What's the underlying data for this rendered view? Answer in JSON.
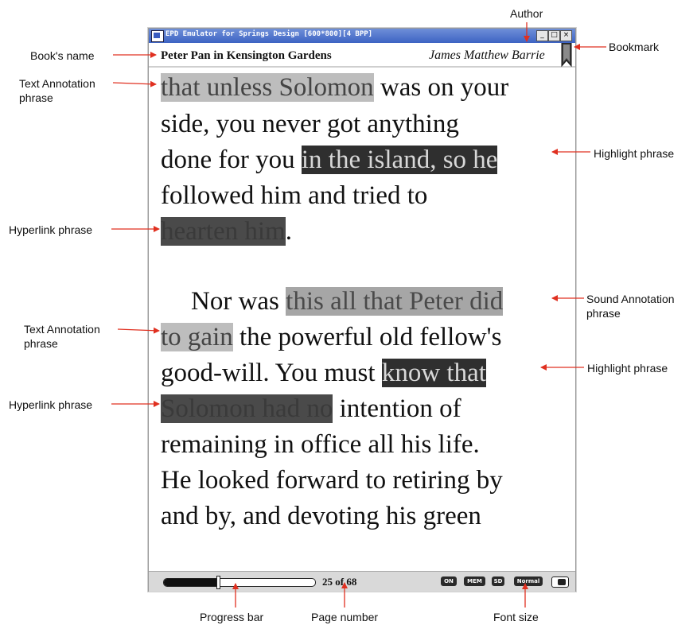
{
  "labels": {
    "author": "Author",
    "bookmark": "Bookmark",
    "book_name": "Book's name",
    "text_annotation_1": "Text Annotation phrase",
    "highlight_1": "Highlight phrase",
    "hyperlink_1": "Hyperlink phrase",
    "sound_annotation": "Sound Annotation phrase",
    "text_annotation_2": "Text Annotation phrase",
    "highlight_2": "Highlight phrase",
    "hyperlink_2": "Hyperlink phrase",
    "progress_bar": "Progress bar",
    "page_number": "Page number",
    "font_size": "Font size"
  },
  "window": {
    "title": "EPD Emulator for Springs Design [600*800][4 BPP]",
    "minimize": "_",
    "maximize": "□",
    "close": "×"
  },
  "book": {
    "name": "Peter Pan in Kensington Gardens",
    "author": "James Matthew Barrie"
  },
  "text": {
    "l1_a": "that unless Solomon",
    "l1_b": " was on your",
    "l2": "side, you never got anything",
    "l3_a": "done for you ",
    "l3_b": "in the island, so he",
    "l4": "followed him and tried to",
    "l5_a": "hearten him",
    "l5_b": ".",
    "l6_a": "Nor was ",
    "l6_b": "this all that Peter did",
    "l7_a": "to gain",
    "l7_b": " the powerful old fellow's",
    "l8_a": "good-will. You must ",
    "l8_b": "know that",
    "l9_a": "Solomon had no",
    "l9_b": " intention of",
    "l10": "remaining in office all his life.",
    "l11": "He looked forward to retiring by",
    "l12": "and by, and devoting his green"
  },
  "status": {
    "progress": 0.35,
    "page_number": "25 of 68",
    "chip_on": "ON",
    "chip_mem": "MEM",
    "chip_sd": "SD",
    "font_size": "Normal"
  }
}
